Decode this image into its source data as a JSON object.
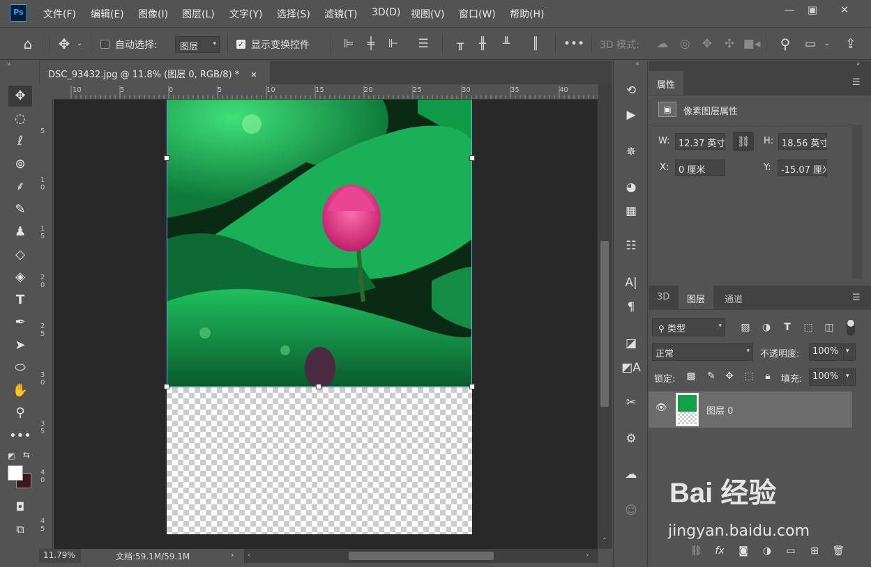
{
  "app": {
    "logo": "Ps"
  },
  "menu": [
    "文件(F)",
    "编辑(E)",
    "图像(I)",
    "图层(L)",
    "文字(Y)",
    "选择(S)",
    "滤镜(T)",
    "3D(D)",
    "视图(V)",
    "窗口(W)",
    "帮助(H)"
  ],
  "options": {
    "auto_select_label": "自动选择:",
    "auto_select_value": "图层",
    "show_transform_label": "显示变换控件",
    "mode_3d_label": "3D 模式:"
  },
  "document": {
    "tab_title": "DSC_93432.jpg @ 11.8% (图层 0, RGB/8) *",
    "close": "✕",
    "zoom": "11.79%",
    "doc_size": "文档:59.1M/59.1M",
    "ruler_h": [
      "10",
      "5",
      "0",
      "5",
      "10",
      "15",
      "20",
      "25",
      "30",
      "35",
      "40"
    ],
    "ruler_v": [
      "5",
      "1\n0",
      "1\n5",
      "2\n0",
      "2\n5",
      "3\n0",
      "3\n5",
      "4\n0",
      "4\n5"
    ]
  },
  "properties": {
    "tab": "属性",
    "section": "像素图层属性",
    "w_label": "W:",
    "w_value": "12.37 英寸",
    "h_label": "H:",
    "h_value": "18.56 英寸",
    "x_label": "X:",
    "x_value": "0 厘米",
    "y_label": "Y:",
    "y_value": "-15.07 厘米"
  },
  "layers_panel": {
    "tabs": [
      "3D",
      "图层",
      "通道"
    ],
    "filter_kind": "类型",
    "blend_mode": "正常",
    "opacity_label": "不透明度:",
    "opacity_value": "100%",
    "lock_label": "锁定:",
    "fill_label": "填充:",
    "fill_value": "100%",
    "layers": [
      {
        "name": "图层 0",
        "visible": true
      }
    ]
  },
  "watermark": {
    "text": "Bai  经验",
    "url": "jingyan.baidu.com"
  },
  "colors": {
    "accent": "#31a8ff",
    "canvas_bg": "#282828",
    "panel": "#535353"
  }
}
